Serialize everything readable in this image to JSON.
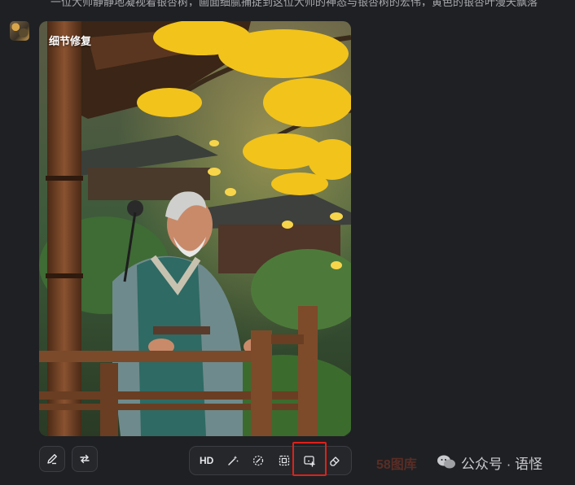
{
  "chat": {
    "top_text": "一位大师静静地凝视着银杏树，画面细腻捕捉到这位大师的神态与银杏树的宏伟，黄色的银杏叶漫天飘落"
  },
  "image_card": {
    "label": "细节修复"
  },
  "left_actions": {
    "edit_icon": "pencil-icon",
    "regenerate_icon": "refresh-icon"
  },
  "toolbar": {
    "hd_label": "HD",
    "tools": [
      "hd",
      "magic-wand-icon",
      "redraw-icon",
      "expand-frame-icon",
      "add-image-icon",
      "eraser-icon"
    ]
  },
  "watermark": {
    "text": "公众号 · 语怪",
    "behind_text": "58图库"
  },
  "colors": {
    "background": "#1f2023",
    "highlight": "#e0201a",
    "ginkgo": "#f2c31b"
  }
}
